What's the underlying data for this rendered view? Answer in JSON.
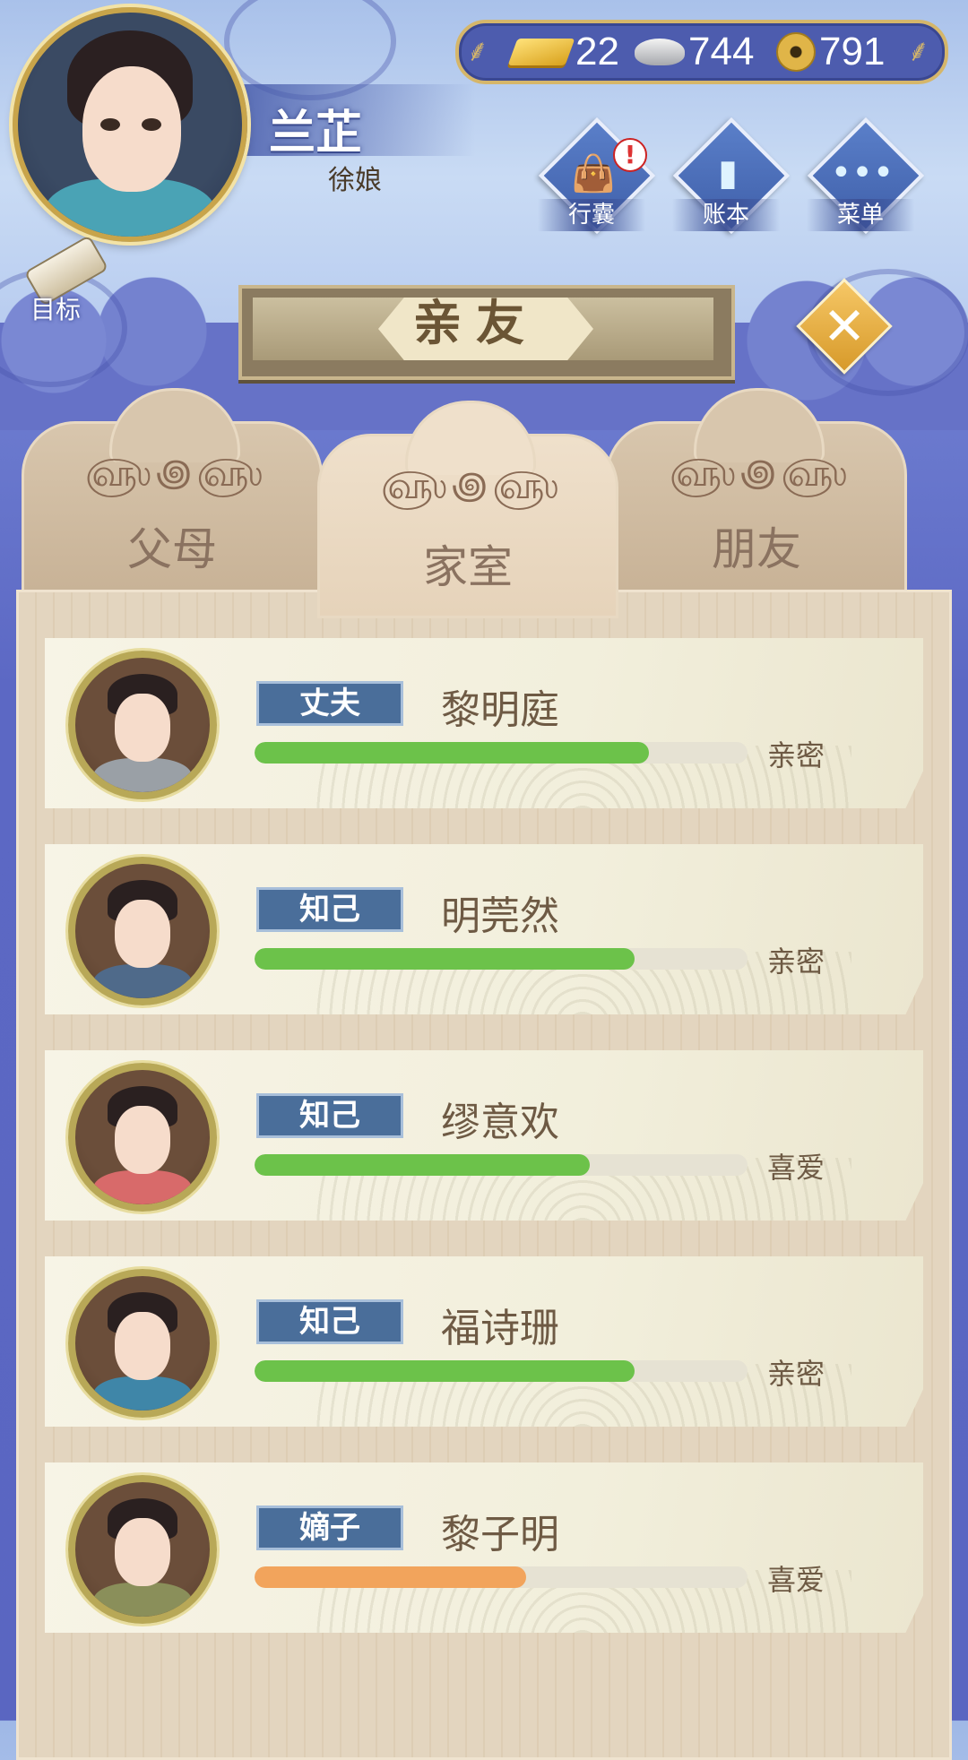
{
  "player": {
    "name": "兰芷",
    "title": "徐娘"
  },
  "currency": {
    "gold": "22",
    "silver": "744",
    "coins": "791"
  },
  "menu": [
    {
      "label": "行囊",
      "icon": "bag-icon",
      "alert": "!"
    },
    {
      "label": "账本",
      "icon": "ledger-icon"
    },
    {
      "label": "菜单",
      "icon": "more-icon"
    }
  ],
  "target": {
    "label": "目标"
  },
  "panel_title": "亲友",
  "tabs": [
    {
      "label": "父母",
      "active": false
    },
    {
      "label": "家室",
      "active": true
    },
    {
      "label": "朋友",
      "active": false
    }
  ],
  "relatives": [
    {
      "role": "丈夫",
      "name": "黎明庭",
      "status": "亲密",
      "affection": 0.8,
      "bar_color": "#6cc24a"
    },
    {
      "role": "知己",
      "name": "明莞然",
      "status": "亲密",
      "affection": 0.77,
      "bar_color": "#6cc24a"
    },
    {
      "role": "知己",
      "name": "缪意欢",
      "status": "喜爱",
      "affection": 0.68,
      "bar_color": "#6cc24a"
    },
    {
      "role": "知己",
      "name": "福诗珊",
      "status": "亲密",
      "affection": 0.77,
      "bar_color": "#6cc24a"
    },
    {
      "role": "嫡子",
      "name": "黎子明",
      "status": "喜爱",
      "affection": 0.55,
      "bar_color": "#f2a45c"
    }
  ],
  "colors": {
    "accent_gold": "#d5b66a",
    "tag_blue": "#4a6e9a",
    "bar_green": "#6cc24a",
    "bar_orange": "#f2a45c"
  }
}
